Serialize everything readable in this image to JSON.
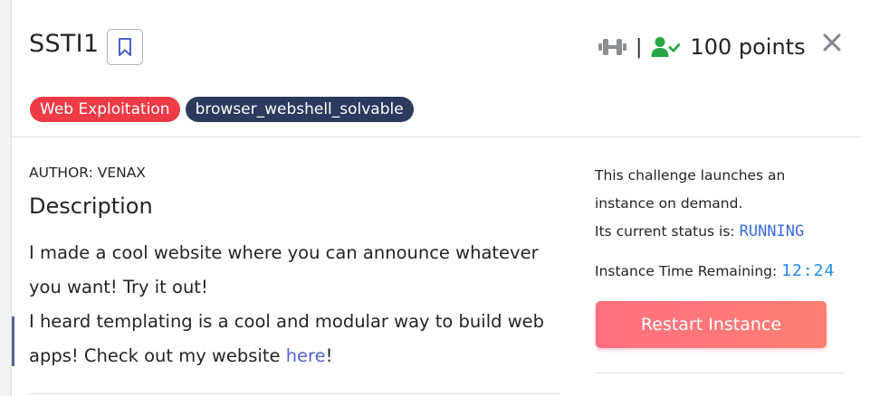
{
  "challenge": {
    "title": "SSTI1",
    "points": "100 points",
    "separator": "|"
  },
  "tags": [
    {
      "label": "Web Exploitation",
      "color": "#ee3b45"
    },
    {
      "label": "browser_webshell_solvable",
      "color": "#2c3a5e"
    }
  ],
  "author": "AUTHOR: VENAX",
  "description": {
    "heading": "Description",
    "line1": "I made a cool website where you can announce whatever you want! Try it out!",
    "line2_before": "I heard templating is a cool and modular way to build web apps! Check out my website ",
    "link_text": "here",
    "line2_after": "!"
  },
  "instance": {
    "launch_text_1": "This challenge launches an",
    "launch_text_2": "instance on demand.",
    "status_label": "Its current status is: ",
    "status_value": "RUNNING",
    "time_label": "Instance Time Remaining: ",
    "time_value": "12:24",
    "restart_label": "Restart Instance"
  },
  "icons": {
    "difficulty": "dumbbell-icon",
    "solved": "user-check-icon",
    "bookmark": "bookmark-icon",
    "close": "close-icon"
  },
  "colors": {
    "accent_link": "#5563d6",
    "status": "#3c68e6",
    "timer": "#1f8ded",
    "solved_icon": "#28a745",
    "restart_button": "#ff7079"
  }
}
